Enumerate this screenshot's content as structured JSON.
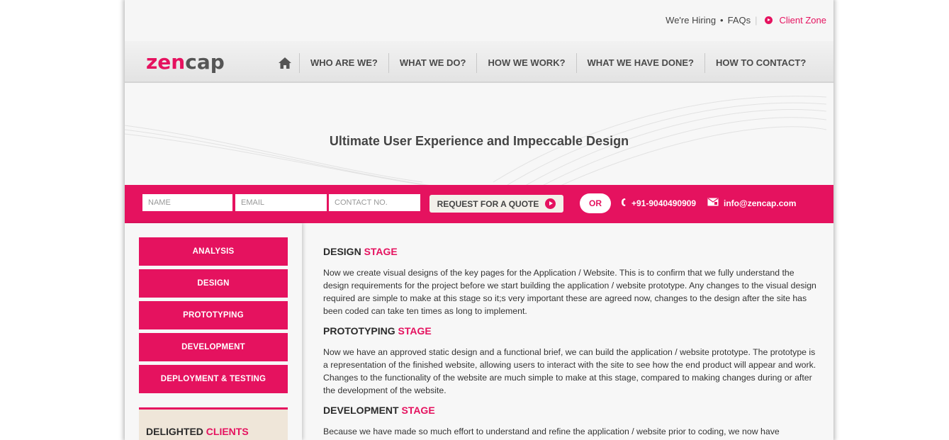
{
  "topbar": {
    "hiring": "We're Hiring",
    "faqs": "FAQs",
    "client_zone": "Client Zone"
  },
  "brand": {
    "logo_part1": "zen",
    "logo_part2": "cap"
  },
  "nav": {
    "home_icon": "home-icon",
    "items": [
      "WHO ARE WE?",
      "WHAT WE DO?",
      "HOW WE WORK?",
      "WHAT WE HAVE DONE?",
      "HOW TO CONTACT?"
    ]
  },
  "hero": {
    "title": "Ultimate User Experience and Impeccable Design"
  },
  "quote": {
    "name_placeholder": "NAME",
    "email_placeholder": "EMAIL",
    "contact_placeholder": "CONTACT NO.",
    "button": "REQUEST FOR A QUOTE",
    "or": "OR",
    "phone": "+91-9040490909",
    "email": "info@zencap.com"
  },
  "sidebar": {
    "stages": [
      "ANALYSIS",
      "DESIGN",
      "PROTOTYPING",
      "DEVELOPMENT",
      "DEPLOYMENT & TESTING"
    ],
    "clients_title_1": "DELIGHTED",
    "clients_title_2": "CLIENTS"
  },
  "content": {
    "sections": [
      {
        "title_1": "DESIGN",
        "title_2": "STAGE",
        "body": "Now we create visual designs of the key pages for the Application / Website. This is to confirm that we fully understand the design requirements for the project before we start building the application / website prototype. Any changes to the visual design required are simple to make at this stage so it;s very important these are agreed now, changes to the design after the site has been coded can take ten times as long to implement."
      },
      {
        "title_1": "PROTOTYPING",
        "title_2": "STAGE",
        "body": "Now we have an approved static design and a functional brief, we can build the application / website prototype. The prototype is a representation of the finished website, allowing users to interact with the site to see how the end product will appear and work. Changes to the functionality of the website are much simple to make at this stage, compared to making changes during or after the development of the website."
      },
      {
        "title_1": "DEVELOPMENT",
        "title_2": "STAGE",
        "body": "Because we have made so much effort to understand and refine the application / website prior to coding, we now have"
      }
    ]
  },
  "colors": {
    "accent": "#e5125f",
    "text": "#333333",
    "clients_bg": "#efe6d9"
  }
}
